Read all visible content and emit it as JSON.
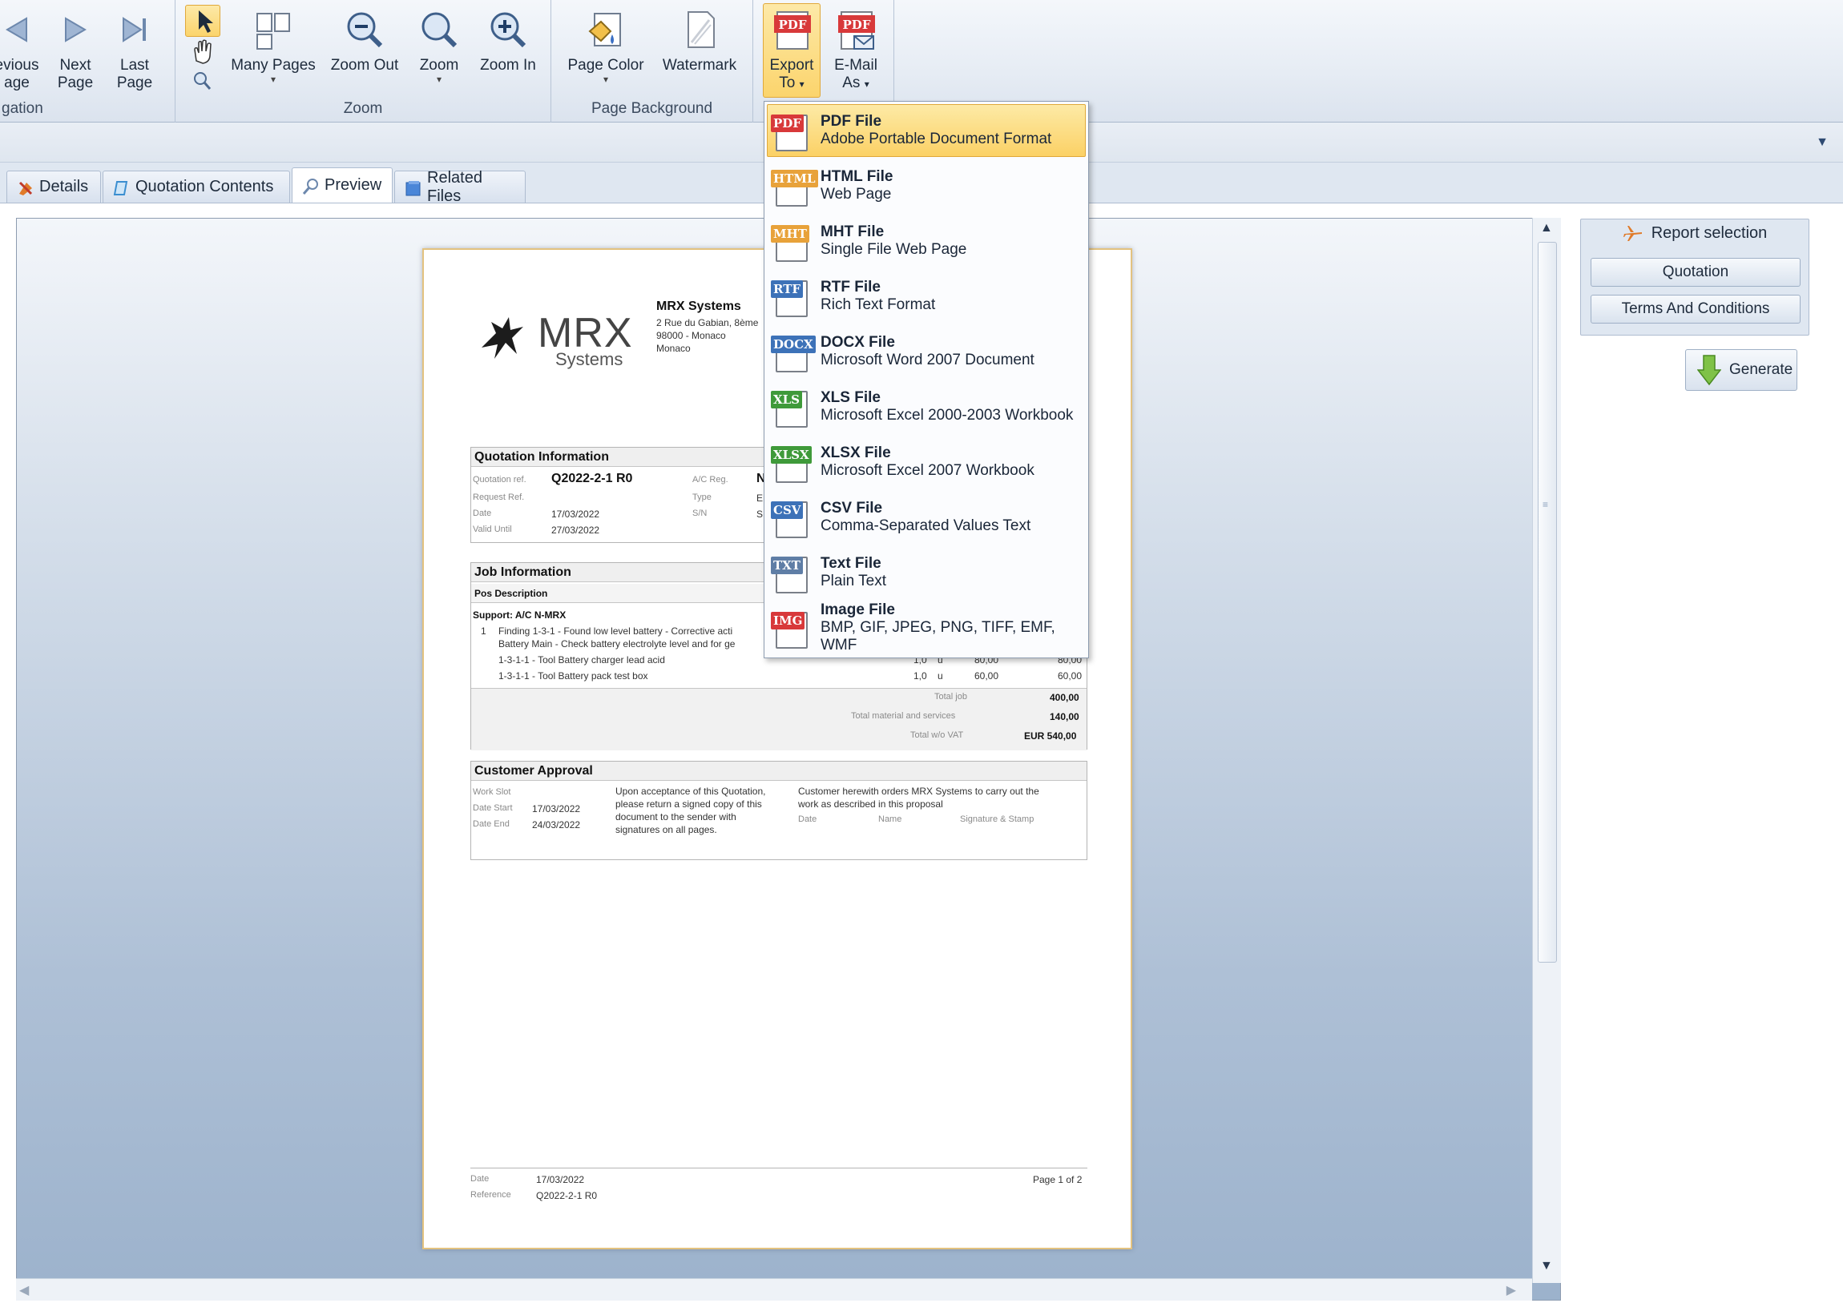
{
  "ribbon": {
    "navigation": {
      "label": "gation",
      "previous": [
        "evious",
        "age"
      ],
      "next": [
        "Next",
        "Page"
      ],
      "last": [
        "Last",
        "Page"
      ]
    },
    "zoom": {
      "label": "Zoom",
      "many_pages": "Many Pages",
      "zoom_out": "Zoom Out",
      "zoom": "Zoom",
      "zoom_in": "Zoom In"
    },
    "background": {
      "label": "Page Background",
      "page_color": "Page Color",
      "watermark": "Watermark"
    },
    "export": {
      "export_to": [
        "Export",
        "To"
      ],
      "email_as": [
        "E-Mail",
        "As"
      ]
    }
  },
  "tabs": [
    {
      "label": "Details"
    },
    {
      "label": "Quotation Contents"
    },
    {
      "label": "Preview"
    },
    {
      "label": "Related Files"
    }
  ],
  "export_menu": [
    {
      "tag": "PDF",
      "color": "#d8393a",
      "name": "PDF File",
      "desc": "Adobe Portable Document Format"
    },
    {
      "tag": "HTML",
      "color": "#e8a23a",
      "name": "HTML File",
      "desc": "Web Page"
    },
    {
      "tag": "MHT",
      "color": "#e8a23a",
      "name": "MHT File",
      "desc": "Single File Web Page"
    },
    {
      "tag": "RTF",
      "color": "#3d72b8",
      "name": "RTF File",
      "desc": "Rich Text Format"
    },
    {
      "tag": "DOCX",
      "color": "#3d72b8",
      "name": "DOCX File",
      "desc": "Microsoft Word 2007 Document"
    },
    {
      "tag": "XLS",
      "color": "#3f9a3a",
      "name": "XLS File",
      "desc": "Microsoft Excel 2000-2003 Workbook"
    },
    {
      "tag": "XLSX",
      "color": "#3f9a3a",
      "name": "XLSX File",
      "desc": "Microsoft Excel 2007 Workbook"
    },
    {
      "tag": "CSV",
      "color": "#3d72b8",
      "name": "CSV File",
      "desc": "Comma-Separated Values Text"
    },
    {
      "tag": "TXT",
      "color": "#5f7ea6",
      "name": "Text File",
      "desc": "Plain Text"
    },
    {
      "tag": "IMG",
      "color": "#d8393a",
      "name": "Image File",
      "desc": "BMP, GIF, JPEG, PNG, TIFF, EMF, WMF"
    }
  ],
  "right_panel": {
    "title": "Report selection",
    "buttons": [
      "Quotation",
      "Terms And Conditions"
    ],
    "generate": "Generate"
  },
  "document": {
    "company": {
      "logo_text": "MRX",
      "logo_sub": "Systems",
      "name": "MRX Systems",
      "address": [
        "2 Rue du Gabian, 8ème",
        "98000 - Monaco",
        "Monaco"
      ]
    },
    "quotation_info": {
      "title": "Quotation Information",
      "ref_label": "Quotation ref.",
      "ref_value": "Q2022-2-1 R0",
      "request_label": "Request Ref.",
      "date_label": "Date",
      "date_value": "17/03/2022",
      "valid_label": "Valid Until",
      "valid_value": "27/03/2022",
      "ac_reg_label": "A/C Reg.",
      "ac_reg_value": "N-",
      "type_label": "Type",
      "type_value": "ER",
      "sn_label": "S/N",
      "sn_value": "SN"
    },
    "job_info": {
      "title": "Job Information",
      "col_header": "Pos Description",
      "group": "Support: A/C N-MRX",
      "line1_pos": "1",
      "line1_text": "Finding 1-3-1 - Found low level battery - Corrective acti",
      "line1_text2": "Battery Main - Check battery electrolyte level and for ge",
      "tool1": "1-3-1-1 - Tool   Battery charger lead acid",
      "tool1_qty": "1,0",
      "tool1_unit": "u",
      "tool1_price": "80,00",
      "tool1_total": "80,00",
      "tool2": "1-3-1-1 - Tool   Battery pack test box",
      "tool2_qty": "1,0",
      "tool2_unit": "u",
      "tool2_price": "60,00",
      "tool2_total": "60,00",
      "total_job_label": "Total job",
      "total_job": "400,00",
      "total_mat_label": "Total material and services",
      "total_mat": "140,00",
      "total_label": "Total w/o VAT",
      "total": "EUR 540,00"
    },
    "approval": {
      "title": "Customer Approval",
      "work_slot": "Work Slot",
      "date_start_label": "Date Start",
      "date_start": "17/03/2022",
      "date_end_label": "Date End",
      "date_end": "24/03/2022",
      "text1": [
        "Upon acceptance of this Quotation,",
        "please return a signed copy of this",
        "document to the sender with",
        "signatures on all pages."
      ],
      "text2": [
        "Customer herewith orders MRX Systems to carry out the",
        "work as described in this proposal"
      ],
      "sig_date": "Date",
      "sig_name": "Name",
      "sig_stamp": "Signature & Stamp"
    },
    "footer": {
      "date_label": "Date",
      "date": "17/03/2022",
      "ref_label": "Reference",
      "ref": "Q2022-2-1 R0",
      "page": "Page 1 of 2"
    }
  }
}
